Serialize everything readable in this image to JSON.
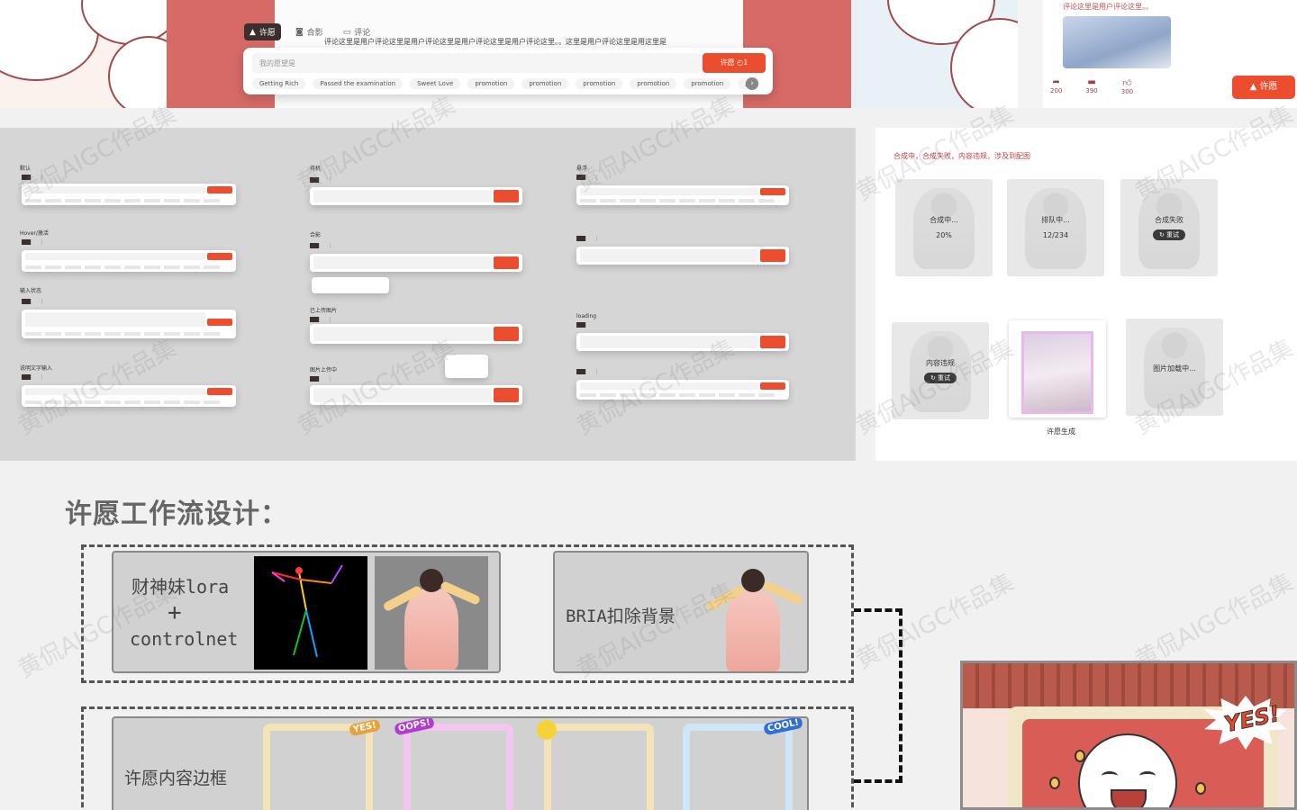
{
  "top": {
    "tabs": [
      {
        "label": "许愿",
        "icon": "wish-icon"
      },
      {
        "label": "合影",
        "icon": "camera-icon"
      },
      {
        "label": "评论",
        "icon": "comment-icon"
      }
    ],
    "comment_text": "评论这里是用户评论这里是用户评论这里是用户评论这里是用户评论这里。。这里是用户评论这里是用这里是",
    "input_placeholder": "我的愿望是",
    "wish_button": "许愿",
    "chips": [
      "Getting Rich",
      "Passed the examination",
      "Sweet Love",
      "promotion",
      "promotion",
      "promotion",
      "promotion",
      "promotion",
      "pr"
    ],
    "post_text": "评论这里是用户评论这里。。",
    "stats": [
      {
        "icon": "share-icon",
        "value": "200"
      },
      {
        "icon": "comment-icon",
        "value": "390"
      },
      {
        "icon": "like-icon",
        "value": "300"
      }
    ],
    "wish_pill": "许愿"
  },
  "states": {
    "labels": [
      "默认",
      "Hover/激活",
      "输入状态",
      "说明文字输入",
      "待机",
      "合影",
      "已上传图片",
      "图片上传中",
      "悬浮",
      "loading"
    ]
  },
  "panel": {
    "title": "合成中，合成失败，内容违规，涉及到配图",
    "cards": [
      {
        "status": "合成中...",
        "detail": "20%"
      },
      {
        "status": "排队中...",
        "detail": "12/234"
      },
      {
        "status": "合成失败",
        "action": "重试"
      },
      {
        "status": "内容违规",
        "action": "重试"
      },
      {
        "status": "图片加载中..."
      }
    ],
    "done_caption": "许愿生成"
  },
  "workflow": {
    "title": "许愿工作流设计：",
    "step1_line1": "财神妹lora",
    "step1_plus": "+",
    "step1_line2": "controlnet",
    "step2": "BRIA扣除背景",
    "step3": "许愿内容边框",
    "badges": [
      "YES!",
      "OOPS!",
      "COOL!"
    ],
    "scene_badge": "YES!"
  },
  "watermark": "黄侃AIGC作品集",
  "colors": {
    "accent": "#ec4d2e",
    "panel_red": "#d76a66",
    "sheet_grey": "#d6d6d6"
  }
}
